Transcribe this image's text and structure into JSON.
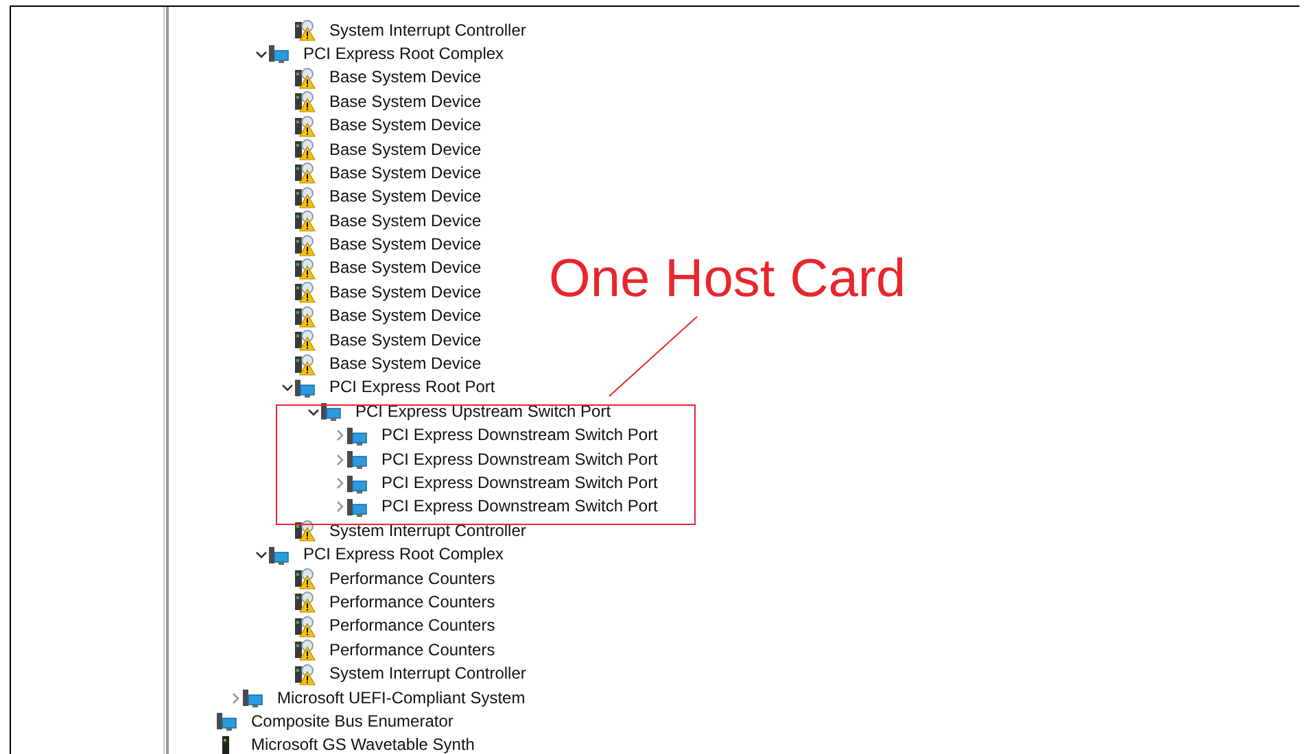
{
  "tree": [
    {
      "children": [
        {
          "children": [
            {
              "children": [
                {
                  "label": "System Interrupt Controller",
                  "kind": "warning"
                }
              ]
            },
            {
              "label": "PCI Express Root Complex",
              "kind": "bus",
              "expanded": true,
              "children": [
                {
                  "label": "Base System Device",
                  "kind": "warning"
                },
                {
                  "label": "Base System Device",
                  "kind": "warning"
                },
                {
                  "label": "Base System Device",
                  "kind": "warning"
                },
                {
                  "label": "Base System Device",
                  "kind": "warning"
                },
                {
                  "label": "Base System Device",
                  "kind": "warning"
                },
                {
                  "label": "Base System Device",
                  "kind": "warning"
                },
                {
                  "label": "Base System Device",
                  "kind": "warning"
                },
                {
                  "label": "Base System Device",
                  "kind": "warning"
                },
                {
                  "label": "Base System Device",
                  "kind": "warning"
                },
                {
                  "label": "Base System Device",
                  "kind": "warning"
                },
                {
                  "label": "Base System Device",
                  "kind": "warning"
                },
                {
                  "label": "Base System Device",
                  "kind": "warning"
                },
                {
                  "label": "Base System Device",
                  "kind": "warning"
                },
                {
                  "label": "PCI Express Root Port",
                  "kind": "bus",
                  "expanded": true,
                  "children": [
                    {
                      "label": "PCI Express Upstream Switch Port",
                      "kind": "bus",
                      "expanded": true,
                      "highlighted": true,
                      "children": [
                        {
                          "label": "PCI Express Downstream Switch Port",
                          "kind": "bus",
                          "expanded": false
                        },
                        {
                          "label": "PCI Express Downstream Switch Port",
                          "kind": "bus",
                          "expanded": false
                        },
                        {
                          "label": "PCI Express Downstream Switch Port",
                          "kind": "bus",
                          "expanded": false
                        },
                        {
                          "label": "PCI Express Downstream Switch Port",
                          "kind": "bus",
                          "expanded": false
                        }
                      ]
                    }
                  ]
                },
                {
                  "label": "System Interrupt Controller",
                  "kind": "warning"
                }
              ]
            },
            {
              "label": "PCI Express Root Complex",
              "kind": "bus",
              "expanded": true,
              "children": [
                {
                  "label": "Performance Counters",
                  "kind": "warning"
                },
                {
                  "label": "Performance Counters",
                  "kind": "warning"
                },
                {
                  "label": "Performance Counters",
                  "kind": "warning"
                },
                {
                  "label": "Performance Counters",
                  "kind": "warning"
                },
                {
                  "label": "System Interrupt Controller",
                  "kind": "warning"
                }
              ]
            }
          ]
        },
        {
          "label": "Microsoft UEFI-Compliant System",
          "kind": "bus",
          "expanded": false
        }
      ]
    },
    {
      "label": "Composite Bus Enumerator",
      "kind": "bus"
    },
    {
      "label": "Microsoft GS Wavetable Synth",
      "kind": "audio"
    }
  ],
  "annotation": {
    "label": "One Host Card"
  }
}
